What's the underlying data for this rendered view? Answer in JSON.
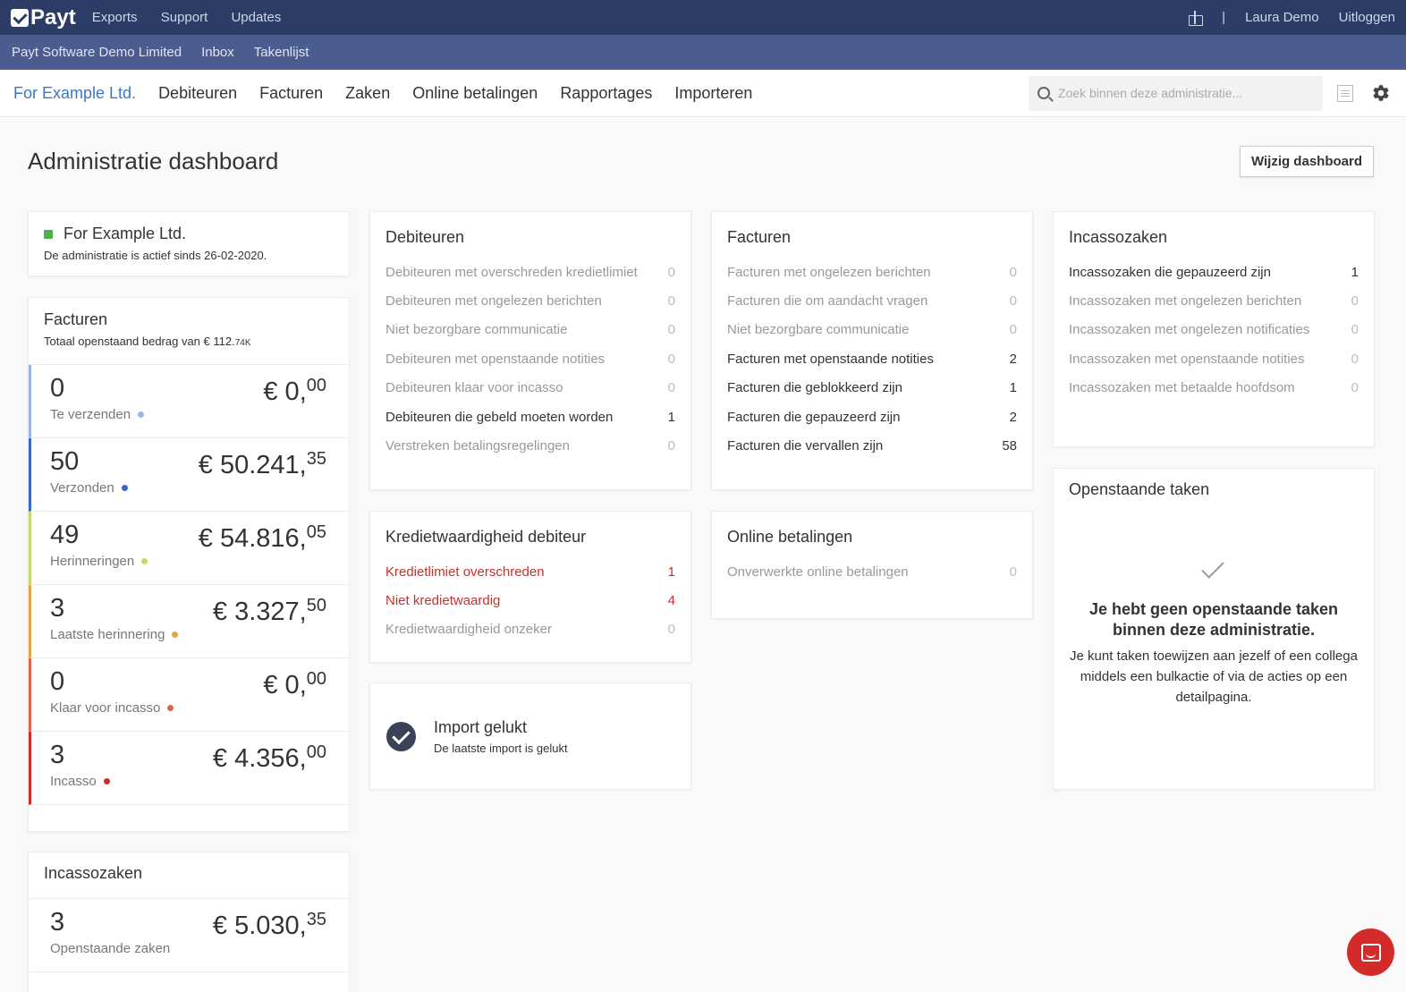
{
  "topbar": {
    "logo": "Payt",
    "nav": [
      "Exports",
      "Support",
      "Updates"
    ],
    "user": "Laura Demo",
    "logout": "Uitloggen",
    "separator": "|"
  },
  "subbar": {
    "items": [
      "Payt Software Demo Limited",
      "Inbox",
      "Takenlijst"
    ]
  },
  "mainnav": {
    "items": [
      "For Example Ltd.",
      "Debiteuren",
      "Facturen",
      "Zaken",
      "Online betalingen",
      "Rapportages",
      "Importeren"
    ],
    "search_placeholder": "Zoek binnen deze administratie..."
  },
  "page": {
    "title": "Administratie dashboard",
    "edit_button": "Wijzig dashboard"
  },
  "company": {
    "name": "For Example Ltd.",
    "status": "De administratie is actief sinds 26-02-2020.",
    "status_color": "#4caf50"
  },
  "invoices": {
    "title": "Facturen",
    "subtitle_prefix": "Totaal openstaand bedrag van € 112.",
    "subtitle_suffix": "74K",
    "stats": [
      {
        "count": "0",
        "amount": "€ 0,",
        "cents": "00",
        "label": "Te verzenden",
        "color": "#9fb5e0"
      },
      {
        "count": "50",
        "amount": "€ 50.241,",
        "cents": "35",
        "label": "Verzonden",
        "color": "#3b66c2"
      },
      {
        "count": "49",
        "amount": "€ 54.816,",
        "cents": "05",
        "label": "Herinneringen",
        "color": "#c7d66e"
      },
      {
        "count": "3",
        "amount": "€ 3.327,",
        "cents": "50",
        "label": "Laatste herinnering",
        "color": "#e0a64a"
      },
      {
        "count": "0",
        "amount": "€ 0,",
        "cents": "00",
        "label": "Klaar voor incasso",
        "color": "#d9664a"
      },
      {
        "count": "3",
        "amount": "€ 4.356,",
        "cents": "00",
        "label": "Incasso",
        "color": "#c8302e"
      }
    ]
  },
  "incasso_summary": {
    "title": "Incassozaken",
    "count": "3",
    "amount": "€ 5.030,",
    "cents": "35",
    "label": "Openstaande zaken"
  },
  "debiteuren": {
    "title": "Debiteuren",
    "rows": [
      {
        "label": "Debiteuren met overschreden kredietlimiet",
        "count": "0"
      },
      {
        "label": "Debiteuren met ongelezen berichten",
        "count": "0"
      },
      {
        "label": "Niet bezorgbare communicatie",
        "count": "0"
      },
      {
        "label": "Debiteuren met openstaande notities",
        "count": "0"
      },
      {
        "label": "Debiteuren klaar voor incasso",
        "count": "0"
      },
      {
        "label": "Debiteuren die gebeld moeten worden",
        "count": "1"
      },
      {
        "label": "Verstreken betalingsregelingen",
        "count": "0"
      }
    ]
  },
  "facturen": {
    "title": "Facturen",
    "rows": [
      {
        "label": "Facturen met ongelezen berichten",
        "count": "0"
      },
      {
        "label": "Facturen die om aandacht vragen",
        "count": "0"
      },
      {
        "label": "Niet bezorgbare communicatie",
        "count": "0"
      },
      {
        "label": "Facturen met openstaande notities",
        "count": "2"
      },
      {
        "label": "Facturen die geblokkeerd zijn",
        "count": "1"
      },
      {
        "label": "Facturen die gepauzeerd zijn",
        "count": "2"
      },
      {
        "label": "Facturen die vervallen zijn",
        "count": "58"
      }
    ]
  },
  "incassozaken": {
    "title": "Incassozaken",
    "rows": [
      {
        "label": "Incassozaken die gepauzeerd zijn",
        "count": "1"
      },
      {
        "label": "Incassozaken met ongelezen berichten",
        "count": "0"
      },
      {
        "label": "Incassozaken met ongelezen notificaties",
        "count": "0"
      },
      {
        "label": "Incassozaken met openstaande notities",
        "count": "0"
      },
      {
        "label": "Incassozaken met betaalde hoofdsom",
        "count": "0"
      }
    ]
  },
  "krediet": {
    "title": "Kredietwaardigheid debiteur",
    "rows": [
      {
        "label": "Kredietlimiet overschreden",
        "count": "1"
      },
      {
        "label": "Niet kredietwaardig",
        "count": "4"
      },
      {
        "label": "Kredietwaardigheid onzeker",
        "count": "0"
      }
    ]
  },
  "online": {
    "title": "Online betalingen",
    "rows": [
      {
        "label": "Onverwerkte online betalingen",
        "count": "0"
      }
    ]
  },
  "import": {
    "title": "Import gelukt",
    "subtitle": "De laatste import is gelukt"
  },
  "tasks": {
    "title": "Openstaande taken",
    "message": "Je hebt geen openstaande taken binnen deze administratie.",
    "description": "Je kunt taken toewijzen aan jezelf of een collega middels een bulkactie of via de acties op een detailpagina."
  },
  "colors": {
    "topbar": "#2c3c66",
    "subbar": "#4b5d8f",
    "accent": "#3d77c4",
    "danger": "#c8302e",
    "chat": "#d32a2a"
  },
  "icons": [
    "gift-icon",
    "search-icon",
    "notes-icon",
    "gear-icon",
    "check-icon",
    "chat-icon"
  ]
}
